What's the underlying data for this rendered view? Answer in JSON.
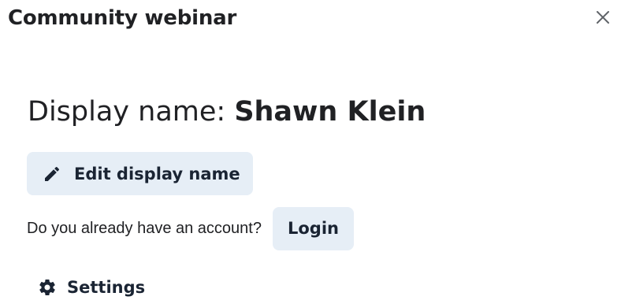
{
  "header": {
    "title": "Community webinar",
    "close_icon": "close-icon"
  },
  "profile": {
    "display_name_prefix": "Display name: ",
    "display_name_value": "Shawn Klein"
  },
  "edit_button": {
    "icon": "pencil-icon",
    "label": "Edit display name"
  },
  "account": {
    "prompt": "Do you already have an account?",
    "login_label": "Login"
  },
  "settings": {
    "icon": "gear-icon",
    "label": "Settings"
  },
  "colors": {
    "button_bg": "#e6eef6",
    "button_text": "#1a2433",
    "text": "#202124"
  }
}
